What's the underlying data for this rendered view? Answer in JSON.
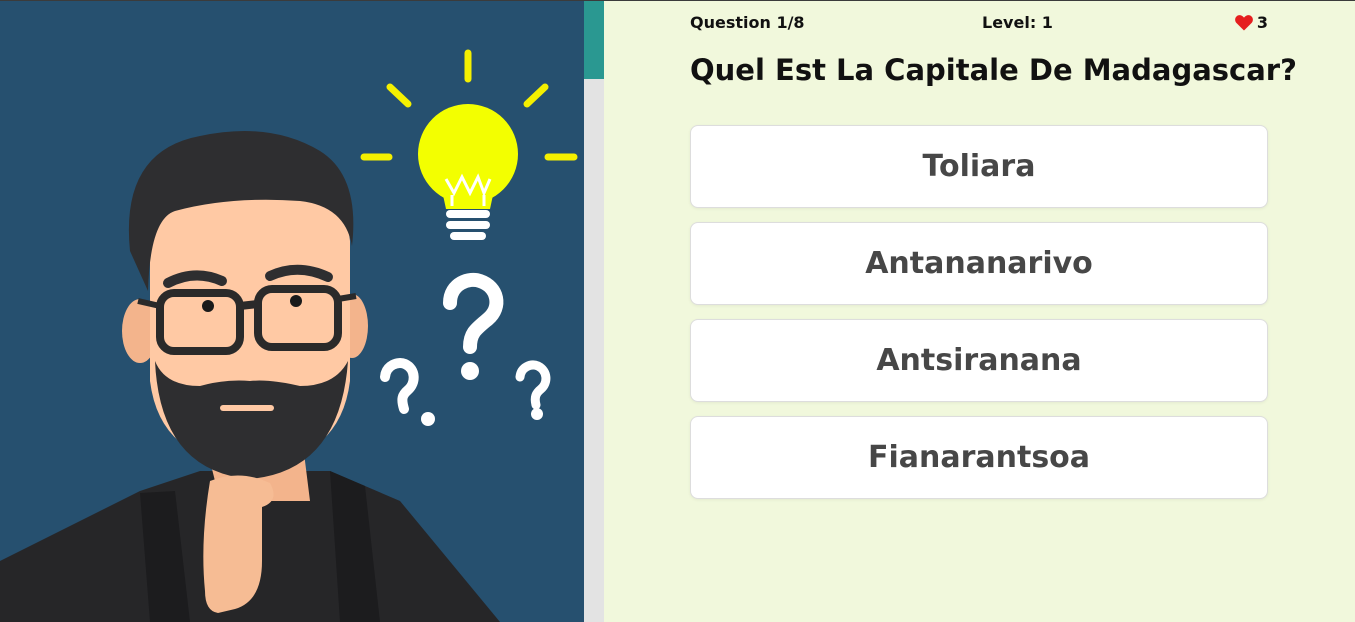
{
  "illustration": {
    "background_color": "#26506f",
    "subject": "thinking-man-with-lightbulb-and-question-marks"
  },
  "scrollbar": {
    "thumb_color": "#2a9891"
  },
  "quiz": {
    "question_counter": "Question 1/8",
    "level": "Level: 1",
    "lives": {
      "icon": "heart-icon",
      "color": "#e51e1e",
      "count": "3"
    },
    "question": "Quel Est La Capitale De Madagascar?",
    "answers": [
      "Toliara",
      "Antananarivo",
      "Antsiranana",
      "Fianarantsoa"
    ]
  }
}
